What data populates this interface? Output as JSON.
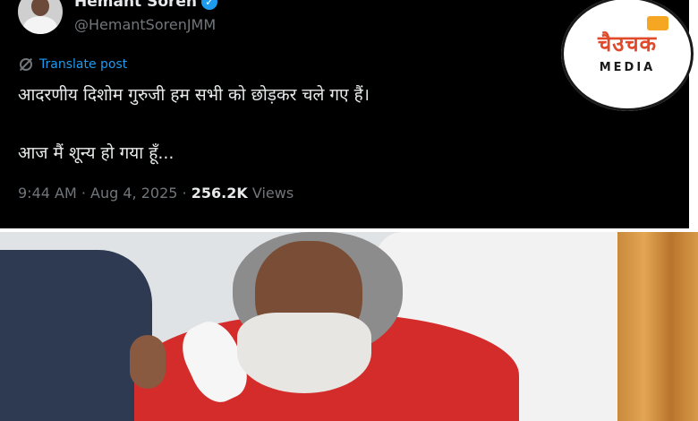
{
  "tweet": {
    "author_name": "Hemant Soren",
    "author_handle": "@HemantSorenJMM",
    "translate_label": "Translate post",
    "lines": [
      "आदरणीय दिशोम गुरुजी हम सभी को छोड़कर चले गए हैं।",
      "आज मैं शून्य हो गया हूँ..."
    ],
    "time": "9:44 AM",
    "date": "Aug 4, 2025",
    "views_count": "256.2K",
    "views_label": "Views",
    "separator": "·"
  },
  "logo": {
    "brand": "चैउचक",
    "sub": "MEDIA"
  },
  "colors": {
    "background": "#000000",
    "text": "#e7e9ea",
    "muted": "#71767b",
    "link": "#1d9bf0",
    "verified": "#1d9bf0"
  },
  "icons": [
    "verified-badge-icon",
    "translate-globe-icon"
  ]
}
